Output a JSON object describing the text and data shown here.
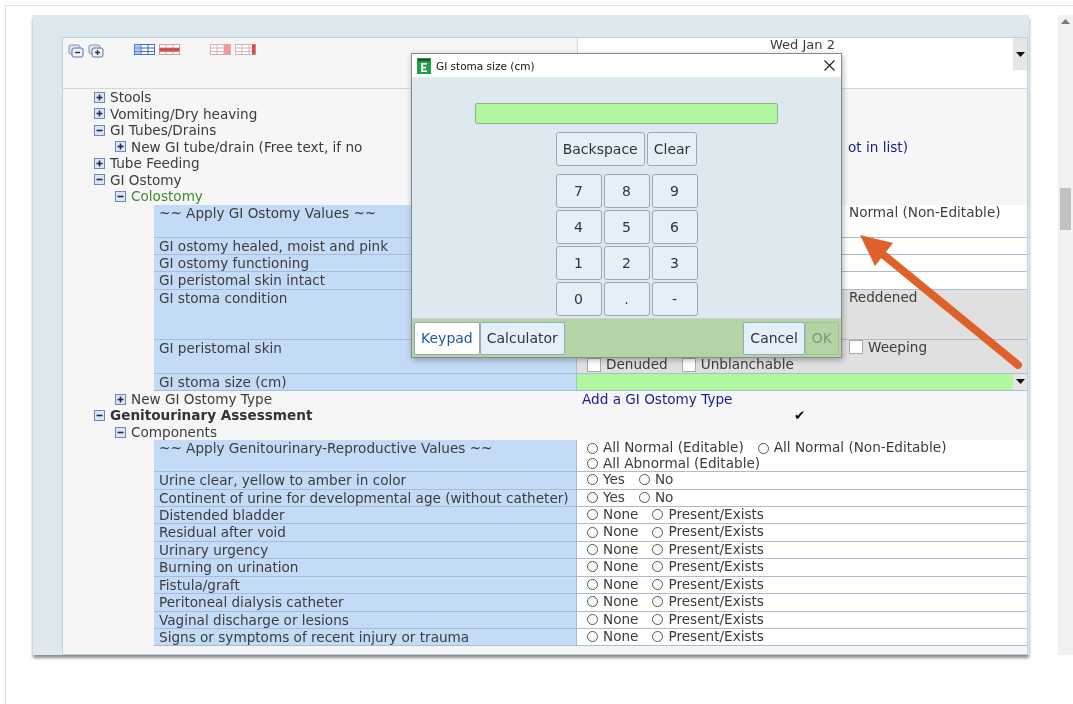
{
  "header": {
    "date": "Wed Jan 2"
  },
  "tree": [
    {
      "kind": "group",
      "label": "Stools",
      "expanded": false
    },
    {
      "kind": "group",
      "label": "Vomiting/Dry heaving",
      "expanded": false
    },
    {
      "kind": "group",
      "label": "GI Tubes/Drains",
      "expanded": true,
      "children": [
        {
          "kind": "group",
          "label": "New GI tube/drain (Free text, if no",
          "expanded": false,
          "link": "ot in list)"
        }
      ]
    },
    {
      "kind": "group",
      "label": "Tube Feeding",
      "expanded": false
    },
    {
      "kind": "group",
      "label": "GI Ostomy",
      "expanded": true,
      "children": [
        {
          "kind": "type",
          "label": "Colostomy",
          "expanded": true,
          "children": [
            {
              "kind": "field",
              "label": "~~ Apply GI Ostomy Values ~~",
              "shaded": false,
              "options": [
                {
                  "kind": "text",
                  "label": "Normal (Non-Editable)"
                }
              ]
            },
            {
              "kind": "field",
              "label": "GI ostomy healed, moist and pink",
              "shaded": false
            },
            {
              "kind": "field",
              "label": "GI ostomy functioning",
              "shaded": false
            },
            {
              "kind": "field",
              "label": "GI peristomal skin intact",
              "shaded": false
            },
            {
              "kind": "field",
              "label": "GI stoma condition",
              "shaded": true,
              "options": [
                {
                  "kind": "text",
                  "label": "Reddened"
                }
              ]
            },
            {
              "kind": "field",
              "label": "GI peristomal skin",
              "shaded": true,
              "options": [
                {
                  "kind": "checkbox",
                  "label": "Weeping",
                  "checked": false
                },
                {
                  "kind": "checkbox",
                  "label": "Denuded",
                  "checked": false
                },
                {
                  "kind": "checkbox",
                  "label": "Unblanchable",
                  "checked": false
                }
              ]
            },
            {
              "kind": "dropdown",
              "label": "GI stoma size (cm)",
              "shaded": false
            }
          ]
        },
        {
          "kind": "group",
          "label": "New GI Ostomy Type",
          "expanded": false,
          "link": "Add a GI Ostomy Type"
        }
      ]
    },
    {
      "kind": "section",
      "label": "Genitourinary Assessment",
      "expanded": true,
      "mark": "✔",
      "children": [
        {
          "kind": "group",
          "label": "Components",
          "expanded": true,
          "children": [
            {
              "kind": "field",
              "label": "~~ Apply Genitourinary-Reproductive Values ~~",
              "shaded": false,
              "options": [
                {
                  "kind": "radio",
                  "label": "All Normal (Editable)",
                  "selected": false
                },
                {
                  "kind": "radio",
                  "label": "All Normal (Non-Editable)",
                  "selected": false
                },
                {
                  "kind": "radio",
                  "label": "All Abnormal (Editable)",
                  "selected": false
                }
              ]
            },
            {
              "kind": "field",
              "label": "Urine clear, yellow to amber in color",
              "shaded": false,
              "options": [
                {
                  "kind": "radio",
                  "label": "Yes",
                  "selected": false
                },
                {
                  "kind": "radio",
                  "label": "No",
                  "selected": false
                }
              ]
            },
            {
              "kind": "field",
              "label": "Continent of urine for developmental age (without catheter)",
              "shaded": false,
              "options": [
                {
                  "kind": "radio",
                  "label": "Yes",
                  "selected": false
                },
                {
                  "kind": "radio",
                  "label": "No",
                  "selected": false
                }
              ]
            },
            {
              "kind": "field",
              "label": "Distended bladder",
              "shaded": false,
              "options": [
                {
                  "kind": "radio",
                  "label": "None",
                  "selected": false
                },
                {
                  "kind": "radio",
                  "label": "Present/Exists",
                  "selected": false
                }
              ]
            },
            {
              "kind": "field",
              "label": "Residual after void",
              "shaded": false,
              "options": [
                {
                  "kind": "radio",
                  "label": "None",
                  "selected": false
                },
                {
                  "kind": "radio",
                  "label": "Present/Exists",
                  "selected": false
                }
              ]
            },
            {
              "kind": "field",
              "label": "Urinary urgency",
              "shaded": false,
              "options": [
                {
                  "kind": "radio",
                  "label": "None",
                  "selected": false
                },
                {
                  "kind": "radio",
                  "label": "Present/Exists",
                  "selected": false
                }
              ]
            },
            {
              "kind": "field",
              "label": "Burning on urination",
              "shaded": false,
              "options": [
                {
                  "kind": "radio",
                  "label": "None",
                  "selected": false
                },
                {
                  "kind": "radio",
                  "label": "Present/Exists",
                  "selected": false
                }
              ]
            },
            {
              "kind": "field",
              "label": "Fistula/graft",
              "shaded": false,
              "options": [
                {
                  "kind": "radio",
                  "label": "None",
                  "selected": false
                },
                {
                  "kind": "radio",
                  "label": "Present/Exists",
                  "selected": false
                }
              ]
            },
            {
              "kind": "field",
              "label": "Peritoneal dialysis catheter",
              "shaded": false,
              "options": [
                {
                  "kind": "radio",
                  "label": "None",
                  "selected": false
                },
                {
                  "kind": "radio",
                  "label": "Present/Exists",
                  "selected": false
                }
              ]
            },
            {
              "kind": "field",
              "label": "Vaginal discharge or lesions",
              "shaded": false,
              "options": [
                {
                  "kind": "radio",
                  "label": "None",
                  "selected": false
                },
                {
                  "kind": "radio",
                  "label": "Present/Exists",
                  "selected": false
                }
              ]
            },
            {
              "kind": "field",
              "label": "Signs or symptoms of recent injury or trauma",
              "shaded": false,
              "options": [
                {
                  "kind": "radio",
                  "label": "None",
                  "selected": false
                },
                {
                  "kind": "radio",
                  "label": "Present/Exists",
                  "selected": false
                }
              ]
            }
          ]
        }
      ]
    }
  ],
  "dialog": {
    "title": "GI stoma size (cm)",
    "edit_keys": [
      {
        "label": "Backspace"
      },
      {
        "label": "Clear"
      }
    ],
    "digit_keys": [
      {
        "label": "7"
      },
      {
        "label": "8"
      },
      {
        "label": "9"
      },
      {
        "label": "4"
      },
      {
        "label": "5"
      },
      {
        "label": "6"
      },
      {
        "label": "1"
      },
      {
        "label": "2"
      },
      {
        "label": "3"
      },
      {
        "label": "0"
      },
      {
        "label": "."
      },
      {
        "label": "-"
      }
    ],
    "modes": [
      {
        "label": "Keypad",
        "selected": true
      },
      {
        "label": "Calculator",
        "selected": false
      }
    ],
    "actions": [
      {
        "label": "Cancel",
        "disabled": false
      },
      {
        "label": "OK",
        "disabled": true
      }
    ]
  }
}
